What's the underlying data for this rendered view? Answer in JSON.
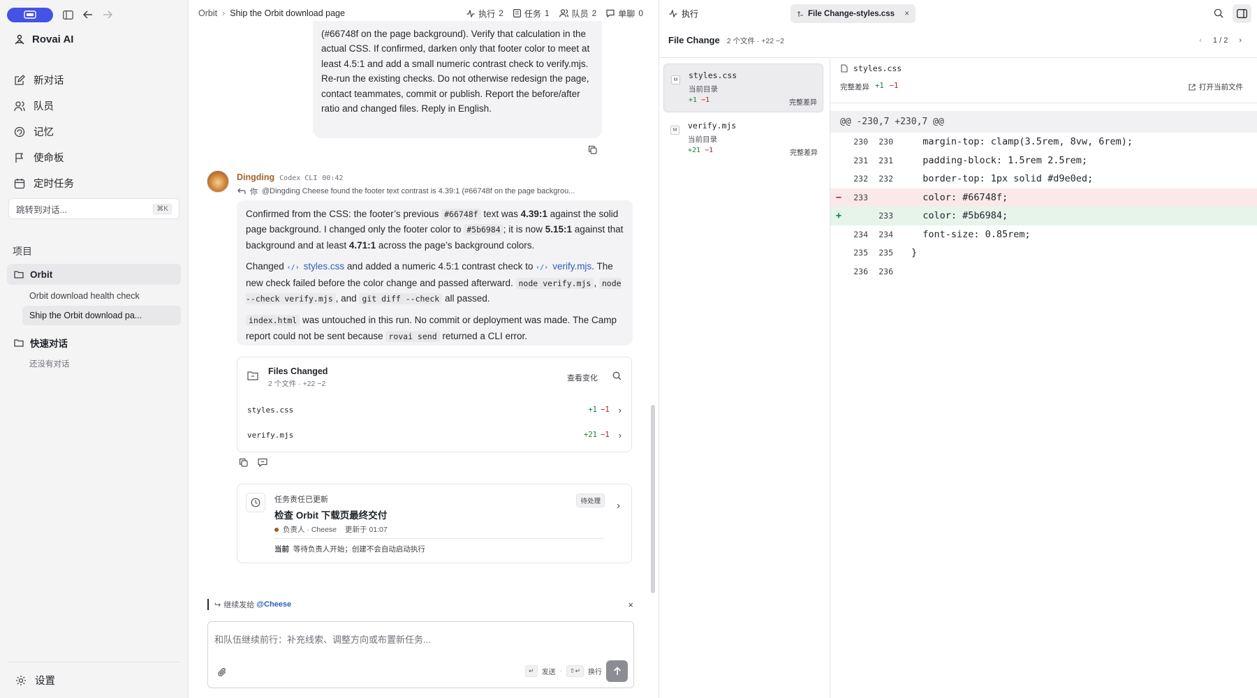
{
  "sidebar": {
    "brand": "Rovai AI",
    "nav": [
      {
        "label": "新对话",
        "icon": "new-chat-icon"
      },
      {
        "label": "队员",
        "icon": "team-icon"
      },
      {
        "label": "记忆",
        "icon": "memory-icon"
      },
      {
        "label": "使命板",
        "icon": "flag-icon"
      },
      {
        "label": "定时任务",
        "icon": "calendar-icon"
      }
    ],
    "jump_placeholder": "跳转到对话...",
    "jump_shortcut": "⌘K",
    "projects_label": "项目",
    "project_name": "Orbit",
    "project_items": [
      "Orbit download health check",
      "Ship the Orbit download pa..."
    ],
    "quick_label": "快速对话",
    "quick_empty": "还没有对话",
    "settings": "设置"
  },
  "header": {
    "crumb_root": "Orbit",
    "crumb_current": "Ship the Orbit download page",
    "stats": [
      {
        "label": "执行",
        "count": "2",
        "icon": "activity-icon"
      },
      {
        "label": "任务",
        "count": "1",
        "icon": "task-icon"
      },
      {
        "label": "队员",
        "count": "2",
        "icon": "team-icon"
      },
      {
        "label": "单聊",
        "count": "0",
        "icon": "chat-icon"
      }
    ]
  },
  "user_message": {
    "text": "(#66748f on the page background). Verify that calculation in the actual CSS. If confirmed, darken only that footer color to meet at least 4.5:1 and add a small numeric contrast check to verify.mjs. Re-run the existing checks. Do not otherwise redesign the page, contact teammates, commit or publish. Report the before/after ratio and changed files. Reply in English."
  },
  "agent_message": {
    "name": "Dingding",
    "tool": "Codex CLI",
    "time": "00:42",
    "reply_to_prefix": "你",
    "reply_to": "@Dingding Cheese found the footer text contrast is 4.39:1 (#66748f on the page backgrou...",
    "p1": {
      "a": "Confirmed from the CSS: the footer’s previous ",
      "c1": "#66748f",
      "b": " text was ",
      "r1": "4.39:1",
      "c": " against the solid page background. I changed only the footer color to ",
      "c2": "#5b6984",
      "d": "; it is now ",
      "r2": "5.15:1",
      "e": " against that background and at least ",
      "r3": "4.71:1",
      "f": " across the page’s background colors."
    },
    "p2": {
      "a": "Changed ",
      "l1": "styles.css",
      "b": " and added a numeric 4.5:1 contrast check to ",
      "l2": "verify.mjs",
      "c": ". The new check failed before the color change and passed afterward. ",
      "c1": "node verify.mjs",
      "d": ", ",
      "c2": "node --check verify.mjs",
      "e": ", and ",
      "c3": "git diff --check",
      "f": " all passed."
    },
    "p3": {
      "c1": "index.html",
      "a": " was untouched in this run. No commit or deployment was made. The Camp report could not be sent because ",
      "c2": "rovai send",
      "b": " returned a CLI error."
    }
  },
  "files_changed": {
    "title": "Files Changed",
    "summary": "2 个文件 · +22 −2",
    "view_label": "查看变化",
    "files": [
      {
        "name": "styles.css",
        "add": "+1",
        "del": "−1"
      },
      {
        "name": "verify.mjs",
        "add": "+21",
        "del": "−1"
      }
    ]
  },
  "task_card": {
    "label": "任务责任已更新",
    "title": "检查 Orbit 下载页最终交付",
    "owner": "负责人 · Cheese",
    "updated": "更新于 01:07",
    "badge": "待处理",
    "current_label": "当前",
    "current_text": "等待负责人开始；创建不会自动启动执行"
  },
  "composer": {
    "continue_prefix": "继续发给",
    "continue_target": "@Cheese",
    "placeholder": "和队伍继续前行：补充线索、调整方向或布置新任务...",
    "send_key": "↵",
    "send_label": "发送",
    "newline_key": "⇧↵",
    "newline_label": "换行"
  },
  "right_panel": {
    "top_label": "执行",
    "tab_label": "File Change-styles.css",
    "title": "File Change",
    "summary": "2 个文件 · +22 −2",
    "pager": "1 / 2",
    "files": [
      {
        "mark": "M",
        "name": "styles.css",
        "loc": "当前目录",
        "add": "+1",
        "del": "−1",
        "full": "完整差异"
      },
      {
        "mark": "M",
        "name": "verify.mjs",
        "loc": "当前目录",
        "add": "+21",
        "del": "−1",
        "full": "完整差异"
      }
    ],
    "diff": {
      "file": "styles.css",
      "full_label": "完整差异",
      "add": "+1",
      "del": "−1",
      "open_label": "打开当前文件",
      "hunk": "@@ -230,7 +230,7 @@",
      "lines": [
        {
          "type": "ctx",
          "old": "230",
          "new": "230",
          "text": "  margin-top: clamp(3.5rem, 8vw, 6rem);"
        },
        {
          "type": "ctx",
          "old": "231",
          "new": "231",
          "text": "  padding-block: 1.5rem 2.5rem;"
        },
        {
          "type": "ctx",
          "old": "232",
          "new": "232",
          "text": "  border-top: 1px solid #d9e0ed;"
        },
        {
          "type": "del",
          "old": "233",
          "new": "",
          "text": "  color: #66748f;"
        },
        {
          "type": "add",
          "old": "",
          "new": "233",
          "text": "  color: #5b6984;"
        },
        {
          "type": "ctx",
          "old": "234",
          "new": "234",
          "text": "  font-size: 0.85rem;"
        },
        {
          "type": "ctx",
          "old": "235",
          "new": "235",
          "text": "}"
        },
        {
          "type": "ctx",
          "old": "236",
          "new": "236",
          "text": ""
        }
      ]
    }
  },
  "colors": {
    "accent": "#4453e6",
    "add": "#15803d",
    "del": "#b91c1c",
    "link": "#2f5fb8"
  }
}
